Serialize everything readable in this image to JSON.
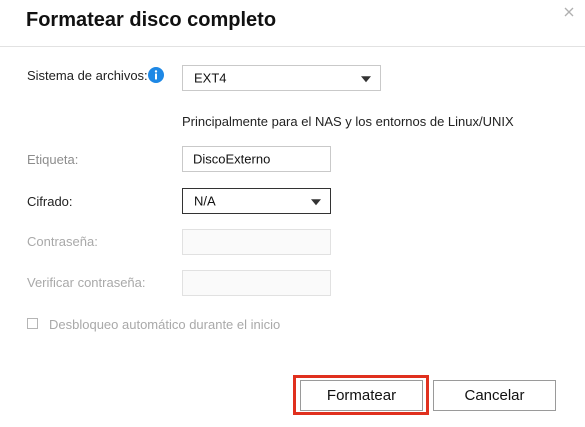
{
  "dialog": {
    "title": "Formatear disco completo"
  },
  "form": {
    "filesystem_label": "Sistema de archivos:",
    "filesystem_value": "EXT4",
    "filesystem_desc": "Principalmente para el NAS y los entornos de Linux/UNIX",
    "label_label": "Etiqueta:",
    "label_value": "DiscoExterno",
    "encryption_label": "Cifrado:",
    "encryption_value": "N/A",
    "password_label": "Contraseña:",
    "password_value": "",
    "verify_label": "Verificar contraseña:",
    "verify_value": "",
    "autounlock_label": "Desbloqueo automático durante el inicio"
  },
  "actions": {
    "format_label": "Formatear",
    "cancel_label": "Cancelar"
  },
  "colors": {
    "info_icon": "#1e88e5",
    "highlight": "#e0301e"
  }
}
